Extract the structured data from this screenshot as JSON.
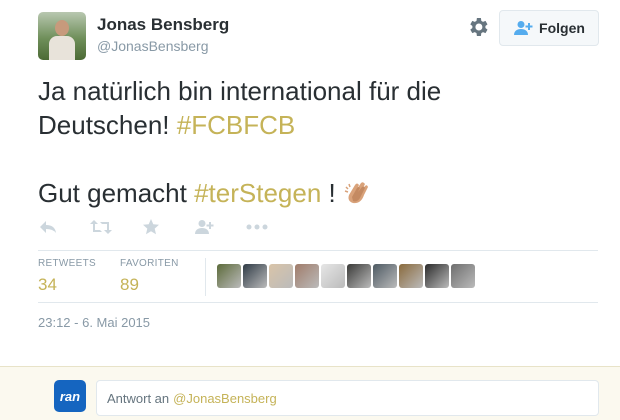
{
  "author": {
    "name": "Jonas Bensberg",
    "handle": "@JonasBensberg"
  },
  "follow_button": {
    "label": "Folgen"
  },
  "tweet": {
    "line1": "Ja natürlich bin international für die",
    "line2_text": "Deutschen! ",
    "line2_hashtag": "#FCBFCB",
    "line3_text": "Gut gemacht ",
    "line3_hashtag": "#terStegen",
    "line3_after": " !",
    "emoji": "clapping-hands-icon"
  },
  "actions": [
    "reply-icon",
    "retweet-icon",
    "favorite-icon",
    "follow-icon",
    "more-icon"
  ],
  "stats": {
    "retweets_label": "RETWEETS",
    "retweets": "34",
    "favorites_label": "FAVORITEN",
    "favorites": "89"
  },
  "favorited_by_colors": [
    "#5c6b3a",
    "#2f3b46",
    "#d9c4a8",
    "#a07c6a",
    "#e6e6e6",
    "#3a3a38",
    "#4d5a63",
    "#8a6a3c",
    "#2b2b2b",
    "#6e6e6e"
  ],
  "timestamp": "23:12 - 6. Mai 2015",
  "reply": {
    "logo_text": "ran",
    "prefix": "Antwort an",
    "handle": "@JonasBensberg"
  },
  "colors": {
    "hashtag": "#c5b358",
    "text": "#292f33",
    "muted": "#8899a6"
  }
}
